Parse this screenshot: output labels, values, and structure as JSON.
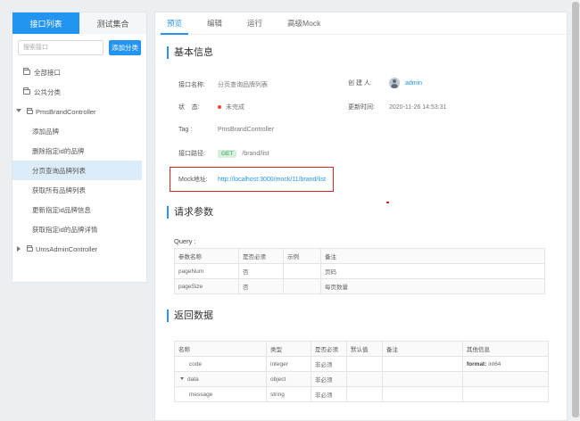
{
  "sidebar": {
    "tabs": [
      "接口列表",
      "测试集合"
    ],
    "search_placeholder": "搜索接口",
    "add_category_label": "添加分类",
    "items": [
      {
        "label": "全部接口"
      },
      {
        "label": "公共分类"
      },
      {
        "label": "PmsBrandController"
      },
      {
        "label": "添加品牌"
      },
      {
        "label": "删除指定id的品牌"
      },
      {
        "label": "分页查询品牌列表"
      },
      {
        "label": "获取所有品牌列表"
      },
      {
        "label": "更新指定id品牌信息"
      },
      {
        "label": "获取指定id的品牌详情"
      },
      {
        "label": "UmsAdminController"
      }
    ]
  },
  "tabs": [
    "预览",
    "编辑",
    "运行",
    "高级Mock"
  ],
  "basic_info": {
    "title": "基本信息",
    "name_label": "接口名称:",
    "name_value": "分页查询品牌列表",
    "creator_label": "创 建 人:",
    "creator_value": "admin",
    "status_label": "状    态:",
    "status_value": "未完成",
    "updated_label": "更新时间:",
    "updated_value": "2020-11-26 14:53:31",
    "tag_label": "Tag :",
    "tag_value": "PmsBrandController",
    "path_label": "接口路径:",
    "method": "GET",
    "path_value": "/brand/list",
    "mock_label": "Mock地址:",
    "mock_url": "http://localhost:3000/mock/11/brand/list"
  },
  "request": {
    "title": "请求参数",
    "query_label": "Query :",
    "headers": [
      "参数名称",
      "是否必须",
      "示例",
      "备注"
    ],
    "rows": [
      [
        "pageNum",
        "否",
        "",
        "页码"
      ],
      [
        "pageSize",
        "否",
        "",
        "每页数量"
      ]
    ]
  },
  "response": {
    "title": "返回数据",
    "headers": [
      "名称",
      "类型",
      "是否必须",
      "默认值",
      "备注",
      "其他信息"
    ],
    "rows": [
      {
        "name": "code",
        "type": "integer",
        "required": "非必须",
        "default": "",
        "note": "",
        "other_key": "format:",
        "other_val": "int64"
      },
      {
        "name": "data",
        "type": "object",
        "required": "非必须",
        "default": "",
        "note": "",
        "other_key": "",
        "other_val": ""
      },
      {
        "name": "message",
        "type": "string",
        "required": "非必须",
        "default": "",
        "note": "",
        "other_key": "",
        "other_val": ""
      }
    ]
  },
  "colors": {
    "accent": "#2395f1",
    "status_red": "#f44336",
    "highlight_border": "#d9252a"
  }
}
